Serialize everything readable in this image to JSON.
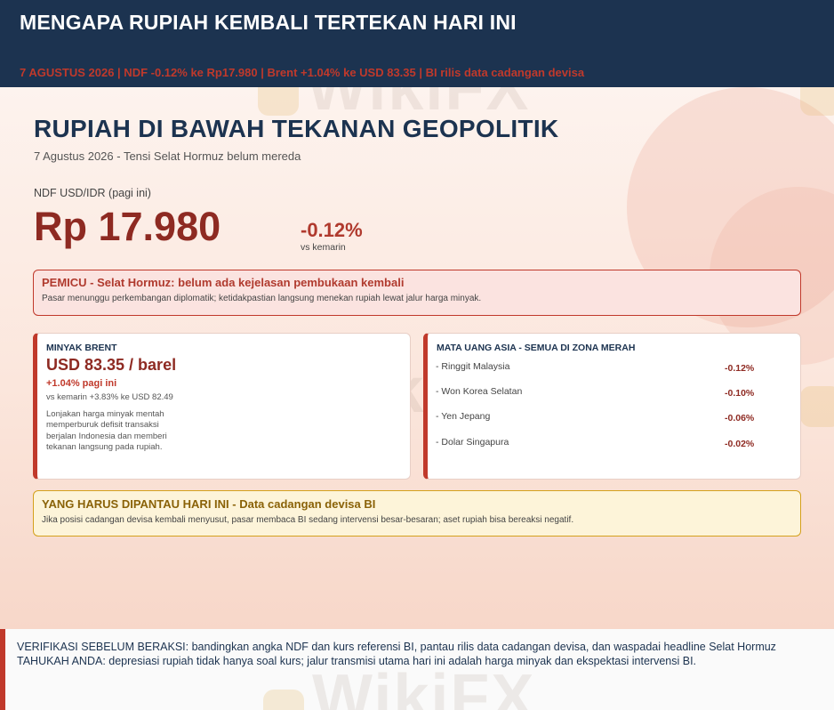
{
  "header": {
    "title": "MENGAPA RUPIAH KEMBALI TERTEKAN HARI INI",
    "ticker": "7 AGUSTUS 2026  |  NDF -0.12% ke Rp17.980  |  Brent +1.04% ke USD 83.35  |  BI rilis data cadangan devisa"
  },
  "main": {
    "title": "RUPIAH DI BAWAH TEKANAN GEOPOLITIK",
    "subtitle": "7 Agustus 2026  -  Tensi Selat Hormuz belum mereda",
    "price_label": "NDF USD/IDR (pagi ini)",
    "price_value": "Rp 17.980",
    "price_change": "-0.12%",
    "price_change_note": "vs  kemarin"
  },
  "trigger": {
    "heading": "PEMICU  -  Selat Hormuz: belum ada kejelasan pembukaan kembali",
    "text": "Pasar menunggu perkembangan diplomatik; ketidakpastian langsung menekan rupiah lewat jalur harga minyak."
  },
  "brent": {
    "label": "MINYAK BRENT",
    "price": "USD 83.35 / barel",
    "change": "+1.04% pagi ini",
    "compare": "vs kemarin +3.83% ke USD 82.49",
    "description": "Lonjakan harga minyak mentah memperburuk defisit transaksi berjalan Indonesia dan memberi tekanan langsung pada rupiah."
  },
  "asia": {
    "label": "MATA UANG ASIA  -  SEMUA DI ZONA MERAH",
    "currencies": [
      {
        "name": "- Ringgit Malaysia",
        "change": "-0.12%"
      },
      {
        "name": "- Won Korea Selatan",
        "change": "-0.10%"
      },
      {
        "name": "- Yen Jepang",
        "change": "-0.06%"
      },
      {
        "name": "- Dolar Singapura",
        "change": "-0.02%"
      }
    ]
  },
  "watch": {
    "heading": "YANG HARUS DIPANTAU HARI INI  -  Data cadangan devisa BI",
    "text": "Jika posisi cadangan devisa kembali menyusut, pasar membaca BI sedang intervensi besar-besaran; aset rupiah bisa bereaksi negatif."
  },
  "footer": {
    "line1": "VERIFIKASI SEBELUM BERAKSI: bandingkan angka NDF dan kurs referensi BI, pantau rilis data cadangan devisa, dan waspadai headline Selat Hormuz",
    "line2": "TAHUKAH ANDA: depresiasi rupiah tidak hanya soal kurs; jalur transmisi utama hari ini adalah harga minyak dan ekspektasi intervensi BI."
  },
  "watermark": "WikiFX",
  "colors": {
    "navy": "#1c3350",
    "accent_red": "#c0392b",
    "dark_red": "#8e2a22",
    "amber": "#d4a01c"
  }
}
